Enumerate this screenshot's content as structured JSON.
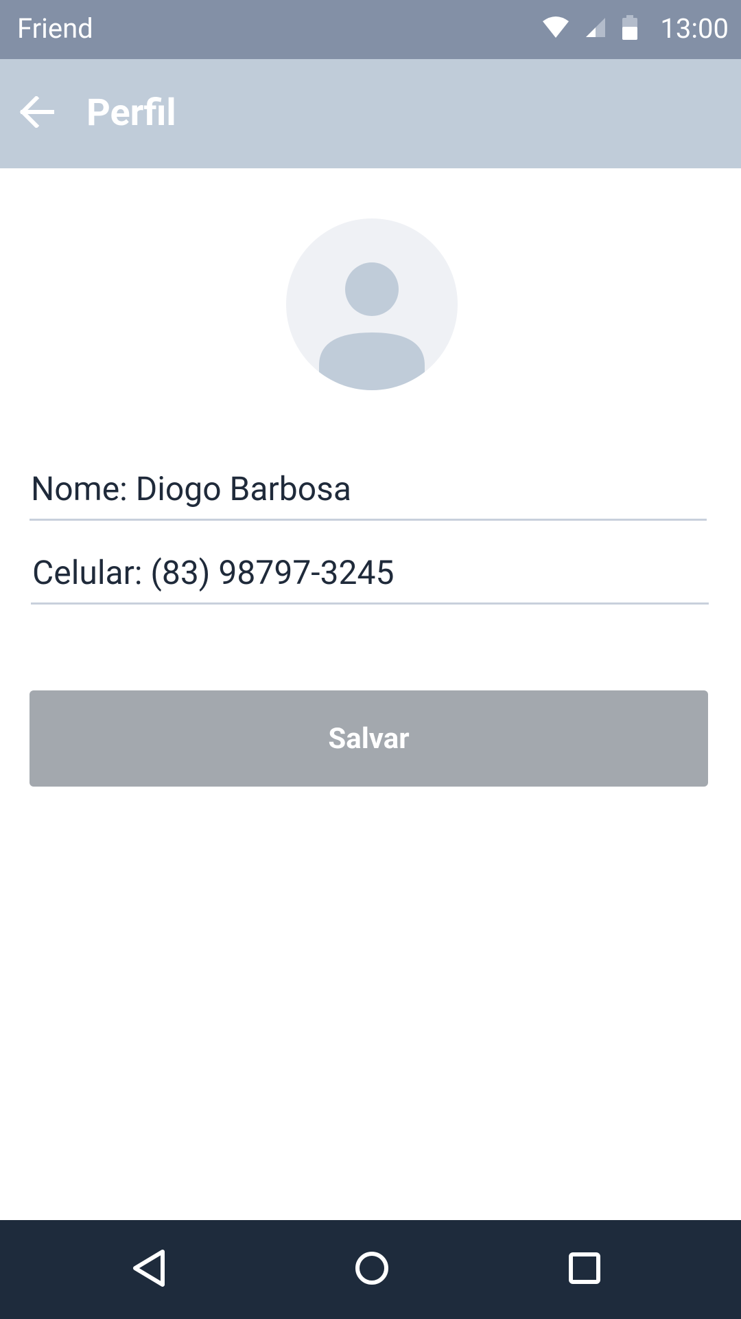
{
  "status_bar": {
    "app_name": "Friend",
    "time": "13:00",
    "icons": [
      "wifi-icon",
      "signal-icon",
      "battery-icon"
    ]
  },
  "toolbar": {
    "title": "Perfil",
    "back_icon": "arrow-left-icon"
  },
  "profile": {
    "avatar_icon": "person-placeholder-icon",
    "name_field": "Nome: Diogo Barbosa",
    "phone_field": "Celular: (83) 98797-3245"
  },
  "actions": {
    "save_label": "Salvar"
  },
  "nav_bar": {
    "buttons": [
      "back-triangle-icon",
      "home-circle-icon",
      "recents-square-icon"
    ]
  },
  "colors": {
    "status_bar": "#8390a6",
    "toolbar": "#c0ccd9",
    "avatar_bg": "#eff1f5",
    "avatar_figure": "#c0ccd9",
    "field_underline": "#c8d0dc",
    "button_disabled": "#a3a8ae",
    "nav_bar": "#1e2b3c"
  }
}
